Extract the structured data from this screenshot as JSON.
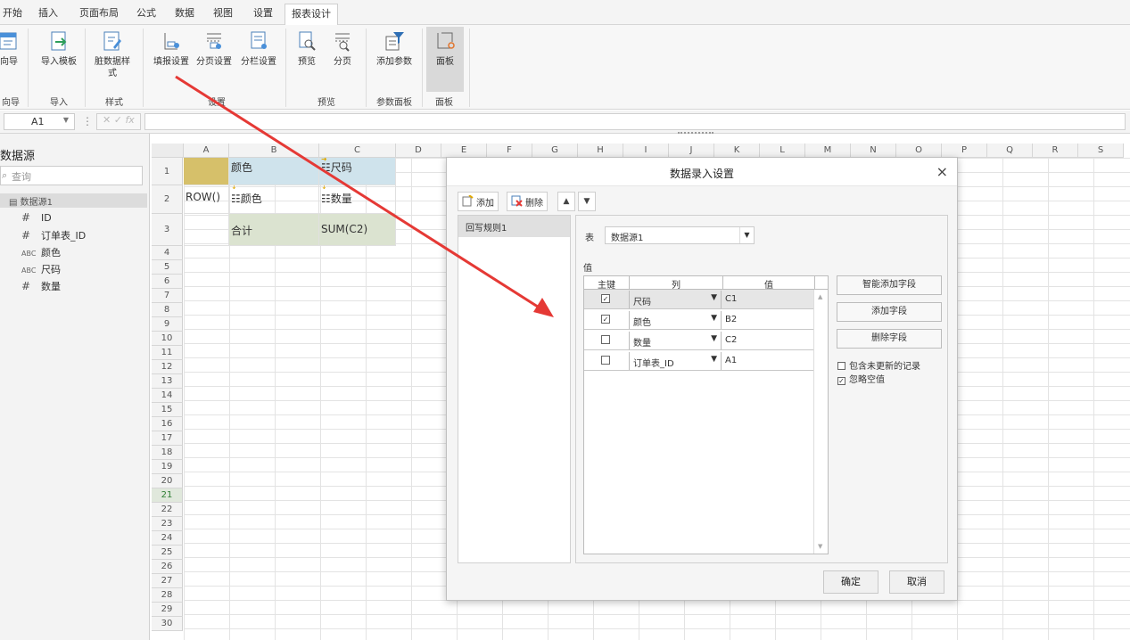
{
  "menu": {
    "tabs": [
      "开始",
      "插入",
      "页面布局",
      "公式",
      "数据",
      "视图",
      "设置",
      "报表设计"
    ],
    "active": "报表设计"
  },
  "ribbon": {
    "buttons": [
      "向导",
      "导入模板",
      "脏数据样式",
      "填报设置",
      "分页设置",
      "分栏设置",
      "预览",
      "分页",
      "添加参数",
      "面板"
    ],
    "groups": [
      "向导",
      "导入",
      "样式",
      "设置",
      "预览",
      "参数面板",
      "面板"
    ]
  },
  "formula_bar": {
    "cell_ref": "A1",
    "fx": "fx"
  },
  "datasource": {
    "title": "数据源",
    "search_placeholder": "查询",
    "root": "数据源1",
    "fields": [
      {
        "type": "#",
        "name": "ID"
      },
      {
        "type": "#",
        "name": "订单表_ID"
      },
      {
        "type": "ABC",
        "name": "颜色"
      },
      {
        "type": "ABC",
        "name": "尺码"
      },
      {
        "type": "#",
        "name": "数量"
      }
    ]
  },
  "sheet": {
    "columns": [
      "A",
      "B",
      "C",
      "D",
      "E",
      "F",
      "G",
      "H",
      "I",
      "J",
      "K",
      "L",
      "M",
      "N",
      "O",
      "P",
      "Q",
      "R",
      "S"
    ],
    "rows": [
      "1",
      "2",
      "3",
      "4",
      "5",
      "6",
      "7",
      "8",
      "9",
      "10",
      "11",
      "12",
      "13",
      "14",
      "15",
      "16",
      "17",
      "18",
      "19",
      "20",
      "21",
      "22",
      "23",
      "24",
      "25",
      "26",
      "27",
      "28",
      "29",
      "30"
    ],
    "cells": {
      "b1": "颜色",
      "c1": "尺码",
      "a2": "ROW()",
      "b2": "颜色",
      "c2": "数量",
      "b3": "合计",
      "c3": "SUM(C2)"
    },
    "colors": {
      "a1": "#d6c06a",
      "header_row": "#cfe3ec",
      "total_row": "#dbe3d0"
    }
  },
  "dialog": {
    "title": "数据录入设置",
    "close": "×",
    "toolbar": {
      "add": "添加",
      "delete": "删除",
      "up": "▲",
      "down": "▼"
    },
    "rules": [
      "回写规则1"
    ],
    "table_label": "表",
    "table_value": "数据源1",
    "value_label": "值",
    "headers": {
      "key": "主键",
      "column": "列",
      "value": "值"
    },
    "rows": [
      {
        "key": true,
        "column": "尺码",
        "value": "C1"
      },
      {
        "key": true,
        "column": "颜色",
        "value": "B2"
      },
      {
        "key": false,
        "column": "数量",
        "value": "C2"
      },
      {
        "key": false,
        "column": "订单表_ID",
        "value": "A1"
      }
    ],
    "side_buttons": [
      "智能添加字段",
      "添加字段",
      "删除字段"
    ],
    "options": [
      {
        "label": "包含未更新的记录",
        "checked": false
      },
      {
        "label": "忽略空值",
        "checked": true
      }
    ],
    "ok": "确定",
    "cancel": "取消",
    "check_mark": "✓"
  },
  "annotation": {
    "arrow_color": "#e53935"
  }
}
